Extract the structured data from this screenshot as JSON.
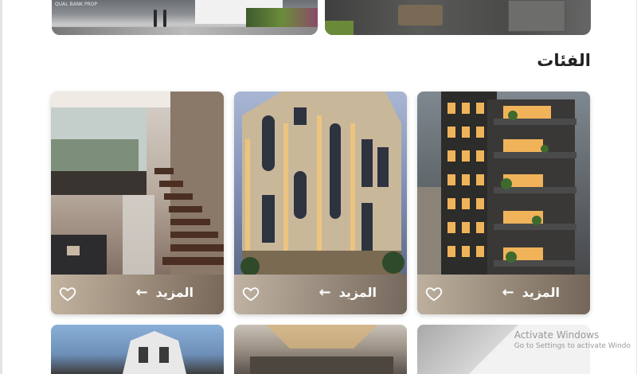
{
  "banners": {
    "first_logo_text": "QUAL BANK\nPROP"
  },
  "categories": {
    "title": "الفئات",
    "cards": [
      {
        "more_label": "المزيد"
      },
      {
        "more_label": "المزيد"
      },
      {
        "more_label": "المزيد"
      }
    ]
  },
  "watermark": {
    "title": "Activate Windows",
    "subtitle": "Go to Settings to activate Windo"
  },
  "icons": {
    "more_arrow": "arrow-left",
    "favorite": "heart-outline"
  }
}
